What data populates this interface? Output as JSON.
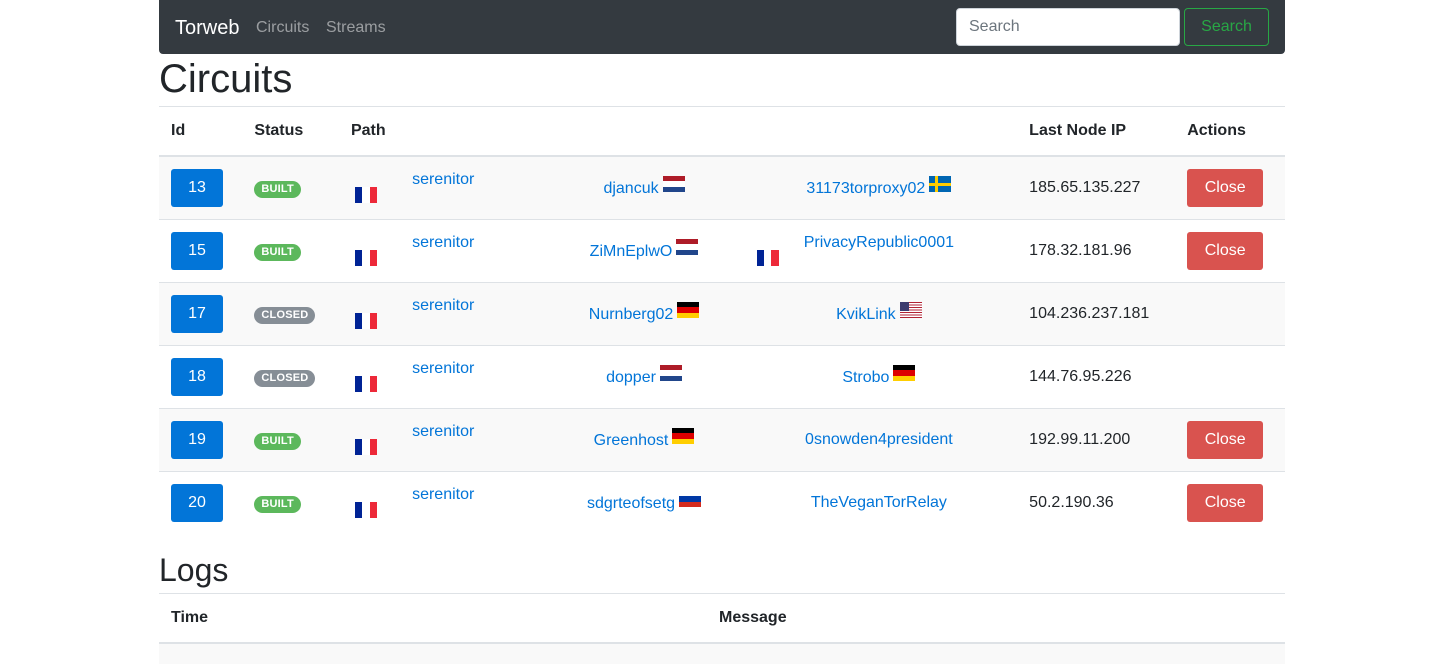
{
  "navbar": {
    "brand": "Torweb",
    "links": [
      "Circuits",
      "Streams"
    ],
    "search_placeholder": "Search",
    "search_button": "Search"
  },
  "circuits": {
    "title": "Circuits",
    "headers": {
      "id": "Id",
      "status": "Status",
      "path": "Path",
      "last_ip": "Last Node IP",
      "actions": "Actions"
    },
    "rows": [
      {
        "id": "13",
        "status": "BUILT",
        "status_kind": "built",
        "path": [
          {
            "name": "serenitor",
            "flag": "fr"
          },
          {
            "name": "djancuk",
            "flag": "nl"
          },
          {
            "name": "31173torproxy02",
            "flag": "se"
          }
        ],
        "ip": "185.65.135.227",
        "action": "Close"
      },
      {
        "id": "15",
        "status": "BUILT",
        "status_kind": "built",
        "path": [
          {
            "name": "serenitor",
            "flag": "fr"
          },
          {
            "name": "ZiMnEplwO",
            "flag": "nl"
          },
          {
            "name": "PrivacyRepublic0001",
            "flag": "fr"
          }
        ],
        "ip": "178.32.181.96",
        "action": "Close"
      },
      {
        "id": "17",
        "status": "CLOSED",
        "status_kind": "closed",
        "path": [
          {
            "name": "serenitor",
            "flag": "fr"
          },
          {
            "name": "Nurnberg02",
            "flag": "de"
          },
          {
            "name": "KvikLink",
            "flag": "us"
          }
        ],
        "ip": "104.236.237.181",
        "action": ""
      },
      {
        "id": "18",
        "status": "CLOSED",
        "status_kind": "closed",
        "path": [
          {
            "name": "serenitor",
            "flag": "fr"
          },
          {
            "name": "dopper",
            "flag": "nl"
          },
          {
            "name": "Strobo",
            "flag": "de"
          }
        ],
        "ip": "144.76.95.226",
        "action": ""
      },
      {
        "id": "19",
        "status": "BUILT",
        "status_kind": "built",
        "path": [
          {
            "name": "serenitor",
            "flag": "fr"
          },
          {
            "name": "Greenhost",
            "flag": "de"
          },
          {
            "name": "0snowden4president",
            "flag": ""
          }
        ],
        "ip": "192.99.11.200",
        "action": "Close"
      },
      {
        "id": "20",
        "status": "BUILT",
        "status_kind": "built",
        "path": [
          {
            "name": "serenitor",
            "flag": "fr"
          },
          {
            "name": "sdgrteofsetg",
            "flag": "ru"
          },
          {
            "name": "TheVeganTorRelay",
            "flag": ""
          }
        ],
        "ip": "50.2.190.36",
        "action": "Close"
      }
    ]
  },
  "logs": {
    "title": "Logs",
    "headers": {
      "time": "Time",
      "message": "Message"
    }
  },
  "colors": {
    "navbar": "#343a40",
    "primary": "#0275d8",
    "success": "#5cb85c",
    "secondary": "#868e96",
    "danger": "#d9534f"
  }
}
